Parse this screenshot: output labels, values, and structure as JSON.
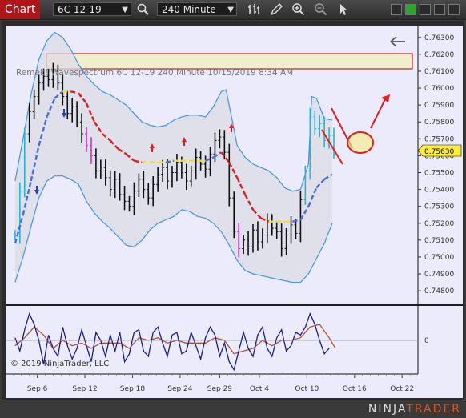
{
  "toolbar": {
    "chart_tab": "Chart",
    "instrument": "6C 12-19",
    "interval": "240 Minute"
  },
  "chart_info": {
    "indicator_label": "Remek! Wavespectrum  6C 12-19  240 Minute  10/15/2019 8:34 AM",
    "copyright": "© 2019 NinjaTrader, LLC",
    "current_price": "0.75630",
    "oscillator_zero": "0"
  },
  "logo": {
    "text_main": "NINJA",
    "text_accent": "TRADER"
  },
  "chart_data": {
    "type": "candlestick",
    "ylim": [
      0.7472,
      0.7637
    ],
    "y_ticks": [
      "0.76300",
      "0.76200",
      "0.76100",
      "0.76000",
      "0.75900",
      "0.75800",
      "0.75700",
      "0.75600",
      "0.75500",
      "0.75400",
      "0.75300",
      "0.75200",
      "0.75100",
      "0.75000",
      "0.74900",
      "0.74800"
    ],
    "x_ticks": [
      "Sep 6",
      "Sep 12",
      "Sep 18",
      "Sep 24",
      "Sep 29",
      "Oct 4",
      "Oct 10",
      "Oct 16",
      "Oct 22"
    ],
    "x_tick_days": [
      6,
      12,
      18,
      24,
      29,
      34,
      40,
      46,
      52
    ],
    "close_series": [
      [
        3.2,
        0.7513
      ],
      [
        3.8,
        0.7539
      ],
      [
        4.4,
        0.7573
      ],
      [
        5.0,
        0.7586
      ],
      [
        5.6,
        0.7595
      ],
      [
        6.2,
        0.7603
      ],
      [
        6.8,
        0.7607
      ],
      [
        7.4,
        0.7605
      ],
      [
        8.0,
        0.761
      ],
      [
        8.6,
        0.7603
      ],
      [
        9.2,
        0.7595
      ],
      [
        9.8,
        0.7585
      ],
      [
        10.4,
        0.7589
      ],
      [
        11.0,
        0.758
      ],
      [
        11.6,
        0.7573
      ],
      [
        12.2,
        0.7566
      ],
      [
        12.8,
        0.756
      ],
      [
        13.4,
        0.7551
      ],
      [
        14.0,
        0.7553
      ],
      [
        14.6,
        0.7547
      ],
      [
        15.2,
        0.754
      ],
      [
        15.8,
        0.7546
      ],
      [
        16.4,
        0.7537
      ],
      [
        17.0,
        0.7533
      ],
      [
        17.6,
        0.753
      ],
      [
        18.2,
        0.7539
      ],
      [
        18.8,
        0.7546
      ],
      [
        19.4,
        0.754
      ],
      [
        20.0,
        0.7535
      ],
      [
        20.6,
        0.7543
      ],
      [
        21.2,
        0.7549
      ],
      [
        21.8,
        0.7553
      ],
      [
        22.4,
        0.7545
      ],
      [
        23.0,
        0.755
      ],
      [
        23.6,
        0.7556
      ],
      [
        24.2,
        0.755
      ],
      [
        24.8,
        0.7545
      ],
      [
        25.4,
        0.7551
      ],
      [
        26.0,
        0.7559
      ],
      [
        26.6,
        0.7555
      ],
      [
        27.2,
        0.7552
      ],
      [
        27.8,
        0.7561
      ],
      [
        28.4,
        0.7569
      ],
      [
        29.0,
        0.7571
      ],
      [
        29.6,
        0.7562
      ],
      [
        30.2,
        0.7535
      ],
      [
        30.8,
        0.7515
      ],
      [
        31.4,
        0.7505
      ],
      [
        32.0,
        0.751
      ],
      [
        32.6,
        0.7506
      ],
      [
        33.2,
        0.7516
      ],
      [
        33.8,
        0.7509
      ],
      [
        34.4,
        0.7513
      ],
      [
        35.0,
        0.7521
      ],
      [
        35.6,
        0.7517
      ],
      [
        36.2,
        0.7515
      ],
      [
        36.8,
        0.7505
      ],
      [
        37.4,
        0.7513
      ],
      [
        38.0,
        0.7519
      ],
      [
        38.6,
        0.7514
      ],
      [
        39.2,
        0.7534
      ],
      [
        39.8,
        0.7551
      ],
      [
        40.4,
        0.7583
      ],
      [
        41.0,
        0.7576
      ],
      [
        41.6,
        0.7579
      ],
      [
        42.2,
        0.7569
      ],
      [
        42.8,
        0.7572
      ],
      [
        43.4,
        0.7563
      ]
    ],
    "ma_series": [
      [
        3.2,
        0.7508
      ],
      [
        4.2,
        0.7525
      ],
      [
        5.2,
        0.7545
      ],
      [
        6.2,
        0.7566
      ],
      [
        7.2,
        0.7583
      ],
      [
        8.2,
        0.7594
      ],
      [
        9.2,
        0.7598
      ],
      [
        10.2,
        0.7598
      ],
      [
        11.2,
        0.7597
      ],
      [
        12.2,
        0.7591
      ],
      [
        13.2,
        0.758
      ],
      [
        14.2,
        0.7573
      ],
      [
        15.2,
        0.7569
      ],
      [
        16.2,
        0.7564
      ],
      [
        17.2,
        0.7561
      ],
      [
        18.2,
        0.7557
      ],
      [
        19.2,
        0.7556
      ],
      [
        20.2,
        0.7556
      ],
      [
        21.2,
        0.7556
      ],
      [
        22.2,
        0.7556
      ],
      [
        23.2,
        0.7557
      ],
      [
        24.2,
        0.7557
      ],
      [
        25.2,
        0.7557
      ],
      [
        26.2,
        0.7557
      ],
      [
        27.2,
        0.7557
      ],
      [
        28.2,
        0.7559
      ],
      [
        29.2,
        0.7562
      ],
      [
        30.2,
        0.7556
      ],
      [
        31.2,
        0.7547
      ],
      [
        32.2,
        0.7537
      ],
      [
        33.2,
        0.7528
      ],
      [
        34.2,
        0.7523
      ],
      [
        35.2,
        0.7521
      ],
      [
        36.2,
        0.7521
      ],
      [
        37.2,
        0.7521
      ],
      [
        38.2,
        0.7521
      ],
      [
        39.2,
        0.7522
      ],
      [
        40.2,
        0.753
      ],
      [
        41.2,
        0.7541
      ],
      [
        42.2,
        0.7546
      ],
      [
        43.2,
        0.7549
      ]
    ],
    "upper_band": [
      [
        3.2,
        0.7545
      ],
      [
        4.2,
        0.757
      ],
      [
        5.2,
        0.7596
      ],
      [
        6.2,
        0.7617
      ],
      [
        7.2,
        0.7628
      ],
      [
        8.2,
        0.7633
      ],
      [
        9.2,
        0.763
      ],
      [
        10.2,
        0.7623
      ],
      [
        11.2,
        0.7614
      ],
      [
        12.2,
        0.7607
      ],
      [
        13.2,
        0.7602
      ],
      [
        14.2,
        0.7598
      ],
      [
        15.2,
        0.7596
      ],
      [
        16.2,
        0.7593
      ],
      [
        17.2,
        0.759
      ],
      [
        18.2,
        0.7585
      ],
      [
        19.2,
        0.758
      ],
      [
        20.2,
        0.7578
      ],
      [
        21.2,
        0.7577
      ],
      [
        22.2,
        0.7578
      ],
      [
        23.2,
        0.7581
      ],
      [
        24.2,
        0.7583
      ],
      [
        25.2,
        0.7584
      ],
      [
        26.2,
        0.7584
      ],
      [
        27.2,
        0.7583
      ],
      [
        28.2,
        0.7589
      ],
      [
        29.2,
        0.7598
      ],
      [
        29.8,
        0.7599
      ],
      [
        30.4,
        0.7585
      ],
      [
        31.2,
        0.7566
      ],
      [
        32.2,
        0.7559
      ],
      [
        33.2,
        0.7555
      ],
      [
        34.2,
        0.7553
      ],
      [
        35.2,
        0.7551
      ],
      [
        36.2,
        0.7547
      ],
      [
        37.2,
        0.7541
      ],
      [
        38.2,
        0.7539
      ],
      [
        39.2,
        0.754
      ],
      [
        40.2,
        0.7555
      ],
      [
        40.6,
        0.7595
      ],
      [
        41.2,
        0.7594
      ],
      [
        42.2,
        0.7582
      ],
      [
        43.2,
        0.7581
      ]
    ],
    "lower_band": [
      [
        3.2,
        0.7485
      ],
      [
        4.2,
        0.75
      ],
      [
        5.2,
        0.7518
      ],
      [
        6.2,
        0.7535
      ],
      [
        7.2,
        0.7545
      ],
      [
        8.2,
        0.7548
      ],
      [
        9.2,
        0.7548
      ],
      [
        10.2,
        0.7546
      ],
      [
        11.2,
        0.7543
      ],
      [
        12.2,
        0.7533
      ],
      [
        13.2,
        0.7526
      ],
      [
        14.2,
        0.7521
      ],
      [
        15.2,
        0.7517
      ],
      [
        16.2,
        0.7512
      ],
      [
        17.2,
        0.7507
      ],
      [
        18.2,
        0.7506
      ],
      [
        19.2,
        0.751
      ],
      [
        20.2,
        0.7516
      ],
      [
        21.2,
        0.752
      ],
      [
        22.2,
        0.7522
      ],
      [
        23.2,
        0.7524
      ],
      [
        24.2,
        0.7528
      ],
      [
        25.2,
        0.7527
      ],
      [
        26.2,
        0.7524
      ],
      [
        27.2,
        0.7523
      ],
      [
        28.2,
        0.752
      ],
      [
        29.2,
        0.7515
      ],
      [
        30.2,
        0.7507
      ],
      [
        31.2,
        0.7498
      ],
      [
        32.2,
        0.7492
      ],
      [
        33.2,
        0.749
      ],
      [
        34.2,
        0.7489
      ],
      [
        35.2,
        0.7488
      ],
      [
        36.2,
        0.7487
      ],
      [
        37.2,
        0.7486
      ],
      [
        38.2,
        0.7485
      ],
      [
        39.2,
        0.7485
      ],
      [
        40.2,
        0.749
      ],
      [
        41.2,
        0.7499
      ],
      [
        42.2,
        0.7508
      ],
      [
        43.2,
        0.752
      ]
    ],
    "osc_ylim": [
      -1.2,
      1.2
    ],
    "osc_fast": [
      [
        3.2,
        0.1
      ],
      [
        3.8,
        -0.4
      ],
      [
        4.4,
        0.4
      ],
      [
        5.0,
        1.0
      ],
      [
        5.6,
        0.6
      ],
      [
        6.2,
        0.0
      ],
      [
        6.8,
        -0.9
      ],
      [
        7.4,
        0.2
      ],
      [
        8.0,
        -0.3
      ],
      [
        8.6,
        -0.6
      ],
      [
        9.2,
        0.5
      ],
      [
        9.8,
        -0.2
      ],
      [
        10.4,
        -0.7
      ],
      [
        11.0,
        -0.3
      ],
      [
        11.6,
        0.4
      ],
      [
        12.2,
        -0.2
      ],
      [
        12.8,
        -0.8
      ],
      [
        13.4,
        0.3
      ],
      [
        14.0,
        0.0
      ],
      [
        14.6,
        -0.6
      ],
      [
        15.2,
        0.2
      ],
      [
        15.8,
        -0.4
      ],
      [
        16.4,
        0.3
      ],
      [
        17.0,
        -0.8
      ],
      [
        17.6,
        -0.5
      ],
      [
        18.2,
        0.3
      ],
      [
        18.8,
        0.4
      ],
      [
        19.4,
        -0.4
      ],
      [
        20.0,
        -0.6
      ],
      [
        20.6,
        0.3
      ],
      [
        21.2,
        0.5
      ],
      [
        21.8,
        -0.1
      ],
      [
        22.4,
        -0.6
      ],
      [
        23.0,
        0.2
      ],
      [
        23.6,
        0.3
      ],
      [
        24.2,
        -0.5
      ],
      [
        24.8,
        -0.4
      ],
      [
        25.4,
        0.3
      ],
      [
        26.0,
        -0.2
      ],
      [
        26.6,
        -0.7
      ],
      [
        27.2,
        0.1
      ],
      [
        27.8,
        0.5
      ],
      [
        28.4,
        0.2
      ],
      [
        29.0,
        -0.6
      ],
      [
        29.6,
        -0.1
      ],
      [
        30.2,
        -0.8
      ],
      [
        30.8,
        -1.1
      ],
      [
        31.4,
        -0.4
      ],
      [
        32.0,
        0.3
      ],
      [
        32.6,
        -0.3
      ],
      [
        33.2,
        -0.6
      ],
      [
        33.8,
        0.2
      ],
      [
        34.4,
        0.5
      ],
      [
        35.0,
        -0.3
      ],
      [
        35.6,
        -0.6
      ],
      [
        36.2,
        0.1
      ],
      [
        36.8,
        0.4
      ],
      [
        37.4,
        -0.4
      ],
      [
        38.0,
        -0.2
      ],
      [
        38.6,
        0.3
      ],
      [
        39.2,
        0.2
      ],
      [
        39.8,
        0.5
      ],
      [
        40.4,
        1.0
      ],
      [
        41.0,
        0.6
      ],
      [
        41.6,
        0.0
      ],
      [
        42.2,
        -0.5
      ],
      [
        42.8,
        -0.3
      ]
    ],
    "osc_slow": [
      [
        3.2,
        -0.2
      ],
      [
        4.4,
        0.1
      ],
      [
        5.6,
        0.5
      ],
      [
        6.8,
        0.2
      ],
      [
        8.0,
        -0.3
      ],
      [
        9.2,
        0.0
      ],
      [
        10.4,
        -0.2
      ],
      [
        11.6,
        -0.1
      ],
      [
        12.8,
        -0.3
      ],
      [
        14.0,
        -0.1
      ],
      [
        15.2,
        -0.1
      ],
      [
        16.4,
        -0.1
      ],
      [
        17.6,
        -0.3
      ],
      [
        18.8,
        0.1
      ],
      [
        20.0,
        0.0
      ],
      [
        21.2,
        0.1
      ],
      [
        22.4,
        -0.1
      ],
      [
        23.6,
        0.0
      ],
      [
        24.8,
        -0.1
      ],
      [
        26.0,
        -0.1
      ],
      [
        27.2,
        -0.1
      ],
      [
        28.4,
        0.1
      ],
      [
        29.6,
        0.0
      ],
      [
        30.8,
        -0.5
      ],
      [
        32.0,
        -0.4
      ],
      [
        33.2,
        -0.3
      ],
      [
        34.4,
        0.0
      ],
      [
        35.6,
        -0.2
      ],
      [
        36.8,
        0.0
      ],
      [
        38.0,
        0.0
      ],
      [
        39.2,
        0.1
      ],
      [
        40.4,
        0.5
      ],
      [
        41.6,
        0.6
      ],
      [
        42.8,
        0.1
      ],
      [
        43.6,
        -0.3
      ]
    ]
  }
}
